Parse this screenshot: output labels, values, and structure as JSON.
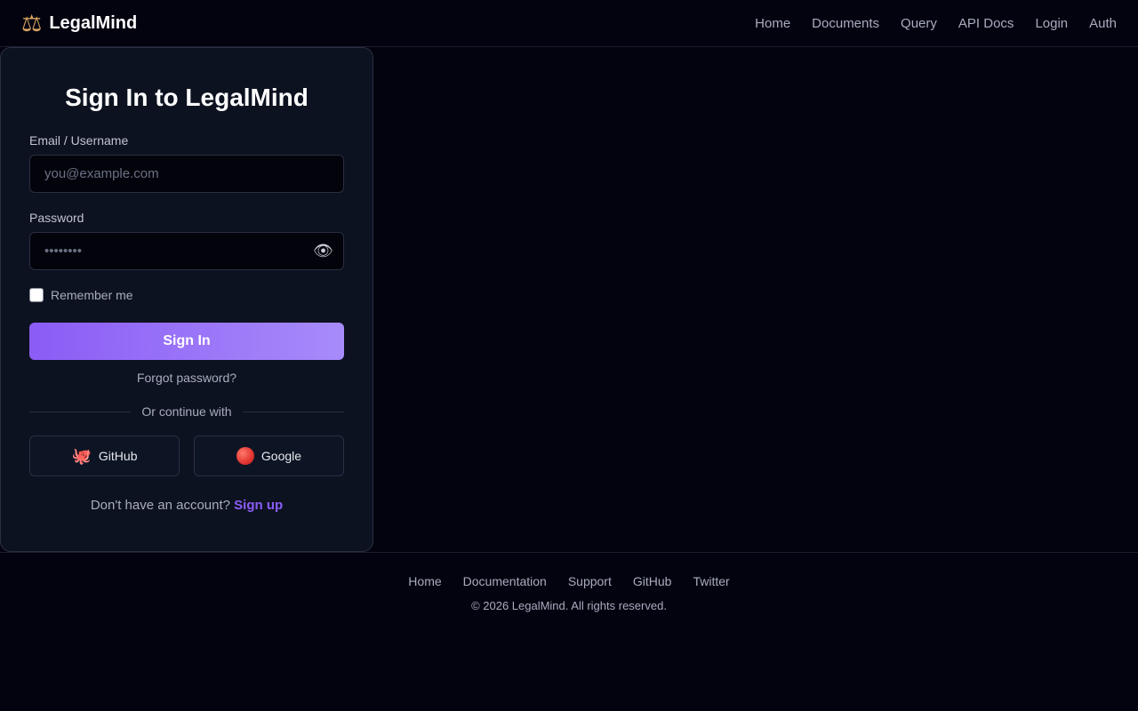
{
  "header": {
    "brand_icon": "scales-icon",
    "brand_name": "LegalMind",
    "nav": [
      "Home",
      "Documents",
      "Query",
      "API Docs",
      "Login",
      "Auth"
    ]
  },
  "login": {
    "title": "Sign In to LegalMind",
    "email_label": "Email / Username",
    "email_placeholder": "you@example.com",
    "email_value": "",
    "password_label": "Password",
    "password_placeholder": "••••••••",
    "password_value": "",
    "password_toggle_icon": "eye-icon",
    "remember_label": "Remember me",
    "remember_checked": false,
    "submit_label": "Sign In",
    "forgot_label": "Forgot password?",
    "divider_label": "Or continue with",
    "github_label": "GitHub",
    "github_icon": "octopus-icon",
    "google_label": "Google",
    "google_icon": "red-circle-icon",
    "signup_prompt": "Don't have an account?",
    "signup_link": "Sign up"
  },
  "footer": {
    "links": [
      "Home",
      "Documentation",
      "Support",
      "GitHub",
      "Twitter"
    ],
    "copyright": "© 2026 LegalMind. All rights reserved."
  },
  "colors": {
    "background": "#03020f",
    "card": "#0d1220",
    "accent": "#8b5cf6",
    "accent_light": "#a78bfa"
  }
}
